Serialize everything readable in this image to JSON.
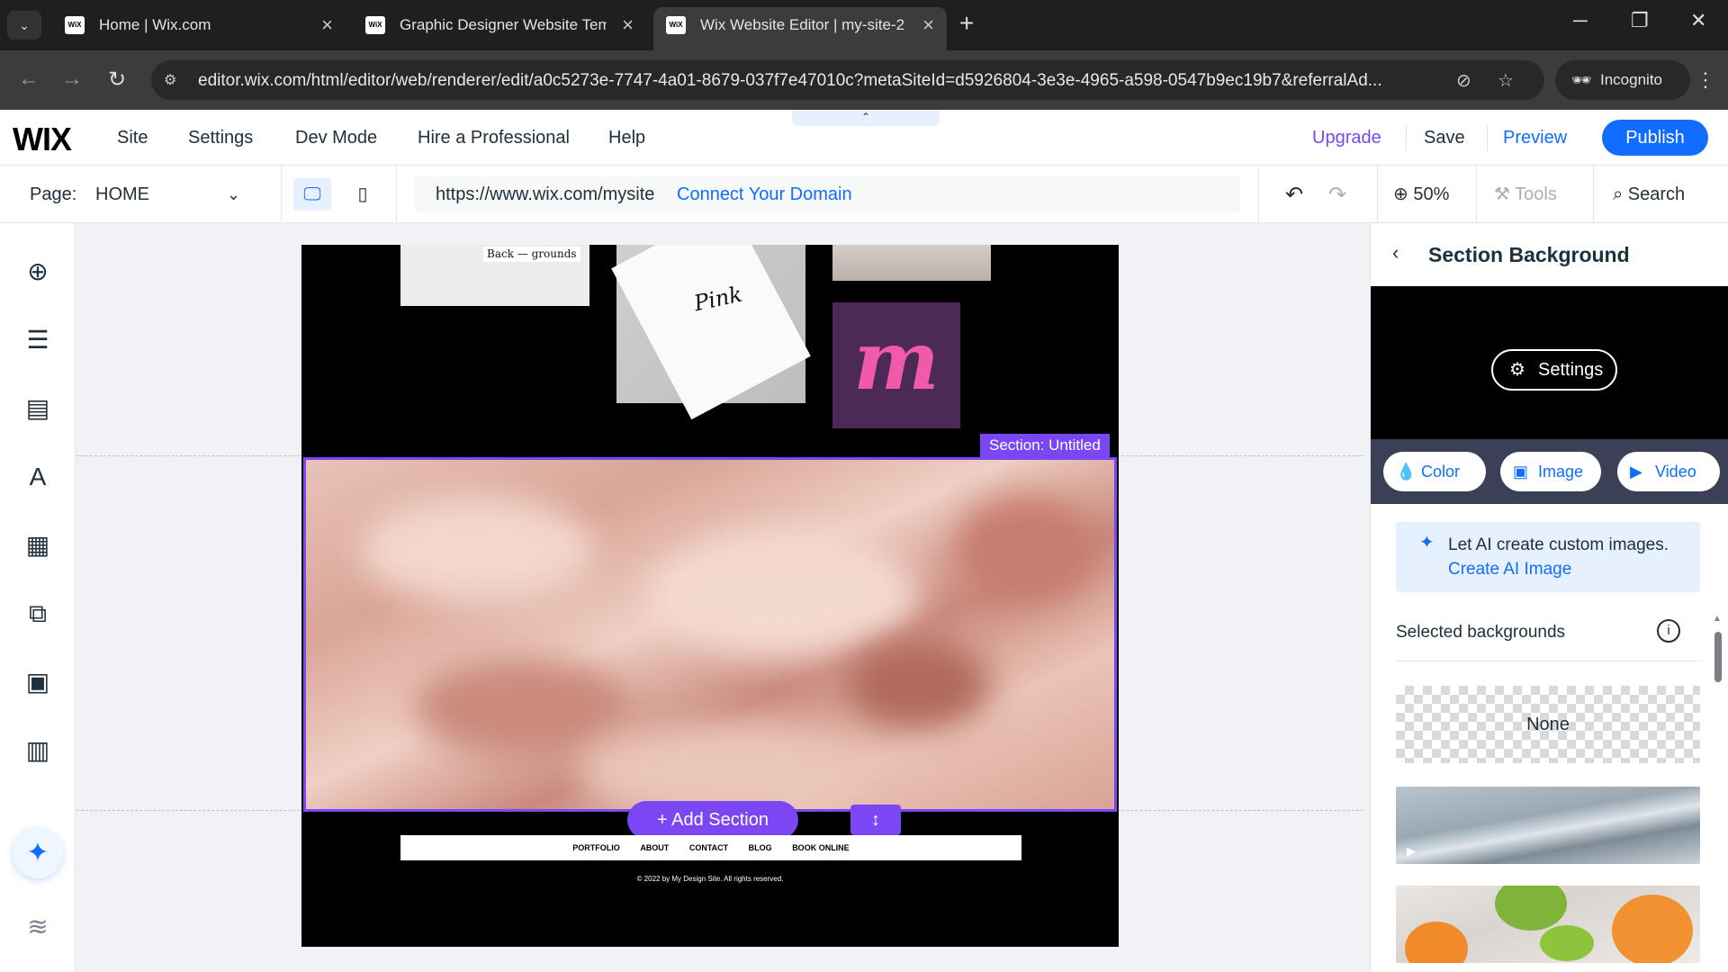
{
  "browser": {
    "tabs": [
      {
        "label": "Home | Wix.com",
        "favicon": "WiX"
      },
      {
        "label": "Graphic Designer Website Temp",
        "favicon": "WiX"
      },
      {
        "label": "Wix Website Editor | my-site-2",
        "favicon": "WiX"
      }
    ],
    "active_tab": 2,
    "url": "editor.wix.com/html/editor/web/renderer/edit/a0c5273e-7747-4a01-8679-037f7e47010c?metaSiteId=d5926804-3e3e-4965-a598-0547b9ec19b7&referralAd...",
    "incognito_label": "Incognito"
  },
  "editor": {
    "logo": "WIX",
    "menu": [
      "Site",
      "Settings",
      "Dev Mode",
      "Hire a Professional",
      "Help"
    ],
    "actions": {
      "upgrade": "Upgrade",
      "save": "Save",
      "preview": "Preview",
      "publish": "Publish"
    },
    "colors": {
      "accent": "#116dff",
      "selection": "#7b47f5"
    }
  },
  "pagebar": {
    "page_label": "Page:",
    "page_name": "HOME",
    "site_url": "https://www.wix.com/mysite",
    "connect_domain": "Connect Your Domain",
    "zoom": "50%",
    "tools": "Tools",
    "search": "Search"
  },
  "canvas": {
    "card1_text": "Back — grounds",
    "card2_text": "Pink",
    "card4_text": "m",
    "section_label": "Section: Untitled",
    "add_section": "+ Add Section",
    "site_nav": [
      "PORTFOLIO",
      "ABOUT",
      "CONTACT",
      "BLOG",
      "BOOK ONLINE"
    ],
    "copyright": "© 2022 by My Design Site. All rights reserved."
  },
  "panel": {
    "title": "Section Background",
    "settings": "Settings",
    "types": [
      "Color",
      "Image",
      "Video"
    ],
    "ai_text": "Let AI create custom images.",
    "ai_link": "Create AI Image",
    "selected_title": "Selected backgrounds",
    "none_label": "None"
  }
}
